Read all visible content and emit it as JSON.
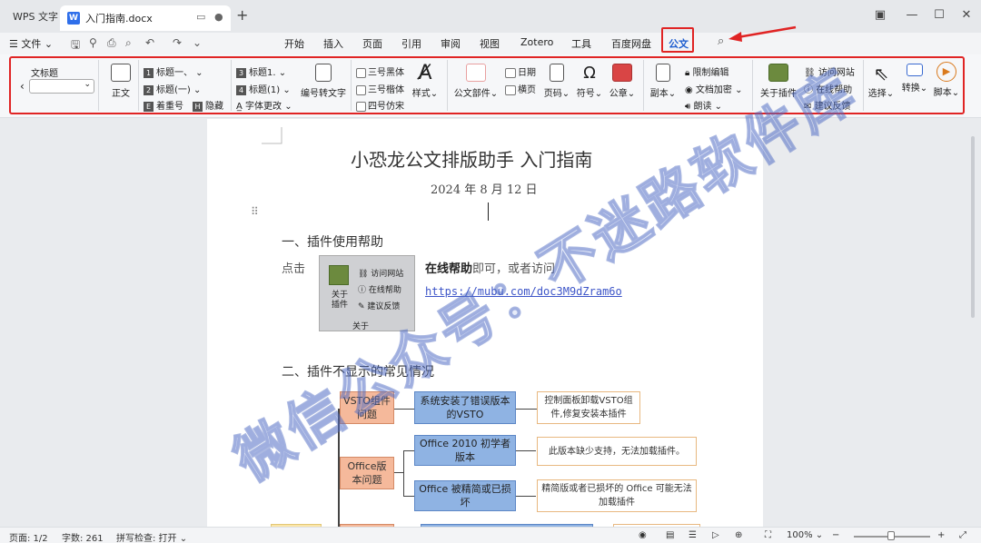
{
  "tabbar": {
    "app_name": "WPS 文字",
    "doc_tab": "入门指南.docx",
    "doc_icon": "W",
    "add_tab": "+"
  },
  "menubar": {
    "file": "文件",
    "tabs": [
      "开始",
      "插入",
      "页面",
      "引用",
      "审阅",
      "视图",
      "Zotero",
      "工具",
      "百度网盘",
      "公文"
    ],
    "active_tab": "公文"
  },
  "ribbon": {
    "style_name": "文标题",
    "zhengwen": "正文",
    "heading_a1": "标题一、",
    "heading_a2": "标题(一)",
    "heading_a3": "着重号",
    "hide": "隐藏",
    "heading_b1": "标题1.",
    "heading_b2": "标题(1)",
    "font_change": "字体更改",
    "num_to_text": "编号转文字",
    "font1": "三号黑体",
    "font2": "三号楷体",
    "font3": "四号仿宋",
    "style": "样式",
    "doc_parts": "公文部件",
    "date": "日期",
    "landscape": "横页",
    "page_num": "页码",
    "symbol": "符号",
    "seal": "公章",
    "copy": "副本",
    "restrict_edit": "限制编辑",
    "encrypt": "文档加密",
    "read_aloud": "朗读",
    "about_plugin": "关于插件",
    "visit_site": "访问网站",
    "online_help": "在线帮助",
    "feedback": "建议反馈",
    "select": "选择",
    "convert": "转换",
    "script": "脚本"
  },
  "document": {
    "title": "小恐龙公文排版助手  入门指南",
    "date": "2024 年 8 月 12 日",
    "section1": "一、插件使用帮助",
    "para1_a": "点击",
    "para1_b": "在线帮助",
    "para1_c": "即可，或者访问",
    "link": "https://mubu.com/doc3M9dZram6o",
    "plugin_pic": {
      "about": "关于插件",
      "visit": "访问网站",
      "help": "在线帮助",
      "feedback": "建议反馈",
      "group": "关于"
    },
    "section2": "二、插件不显示的常见情况",
    "watermark": "微信公众号：不迷路软件库"
  },
  "flowchart": {
    "cat1": "VSTO组件问题",
    "cat2": "Office版本问题",
    "cause1": "系统安装了错误版本的VSTO",
    "cause2": "Office 2010 初学者版本",
    "cause3": "Office 被精简或已损坏",
    "fix1": "控制面板卸载VSTO组件,修复安装本插件",
    "fix2": "此版本缺少支持，无法加载插件。",
    "fix3": "精简版或者已损坏的 Office 可能无法加载插件"
  },
  "statusbar": {
    "page": "页面: 1/2",
    "words": "字数: 261",
    "spell": "拼写检查: 打开",
    "zoom": "100%"
  },
  "colors": {
    "highlight": "#e02424",
    "active_tab": "#1c5ccf",
    "link": "#3d55c8"
  }
}
